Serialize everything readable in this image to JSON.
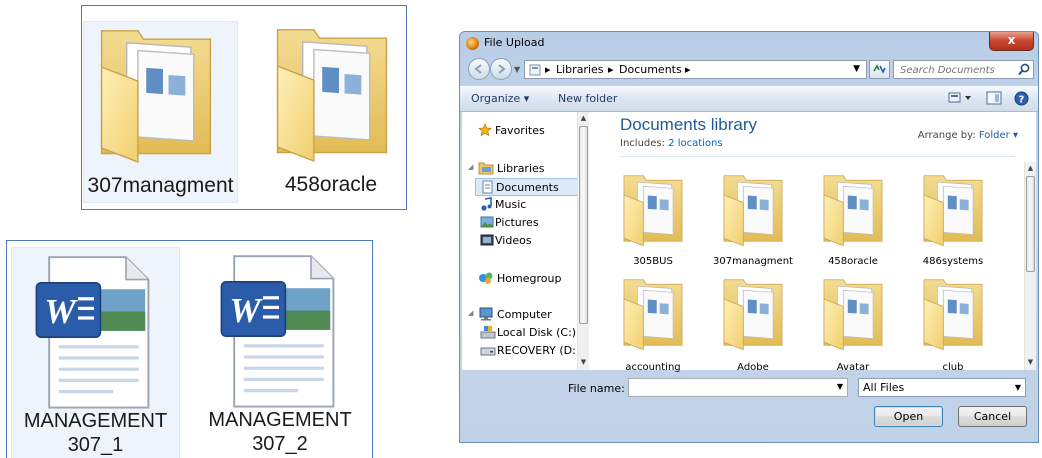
{
  "zoom_top": {
    "items": [
      {
        "label": "307managment",
        "icon": "folder-icon"
      },
      {
        "label": "458oracle",
        "icon": "folder-icon"
      }
    ]
  },
  "zoom_bottom": {
    "items": [
      {
        "line1": "MANAGEMENT",
        "line2": "307_1",
        "icon": "word-document-icon"
      },
      {
        "line1": "MANAGEMENT",
        "line2": "307_2",
        "icon": "word-document-icon"
      }
    ]
  },
  "dialog": {
    "title": "File Upload",
    "close_label": "x",
    "address": {
      "crumbs": [
        "Libraries",
        "Documents"
      ]
    },
    "search_placeholder": "Search Documents",
    "toolbar": {
      "organize": "Organize ▾",
      "new_folder": "New folder"
    },
    "nav": {
      "favorites": "Favorites",
      "libraries": "Libraries",
      "documents": "Documents",
      "music": "Music",
      "pictures": "Pictures",
      "videos": "Videos",
      "homegroup": "Homegroup",
      "computer": "Computer",
      "local_disk": "Local Disk (C:)",
      "recovery": "RECOVERY (D:)"
    },
    "library": {
      "title": "Documents library",
      "includes_label": "Includes:",
      "includes_link": "2 locations",
      "arrange_label": "Arrange by:",
      "arrange_value": "Folder ▾"
    },
    "folders": [
      "305BUS",
      "307managment",
      "458oracle",
      "486systems",
      "accounting",
      "Adobe",
      "Avatar",
      "club"
    ],
    "file_name_label": "File name:",
    "file_name_value": "",
    "file_type": "All Files",
    "open_label": "Open",
    "cancel_label": "Cancel"
  }
}
